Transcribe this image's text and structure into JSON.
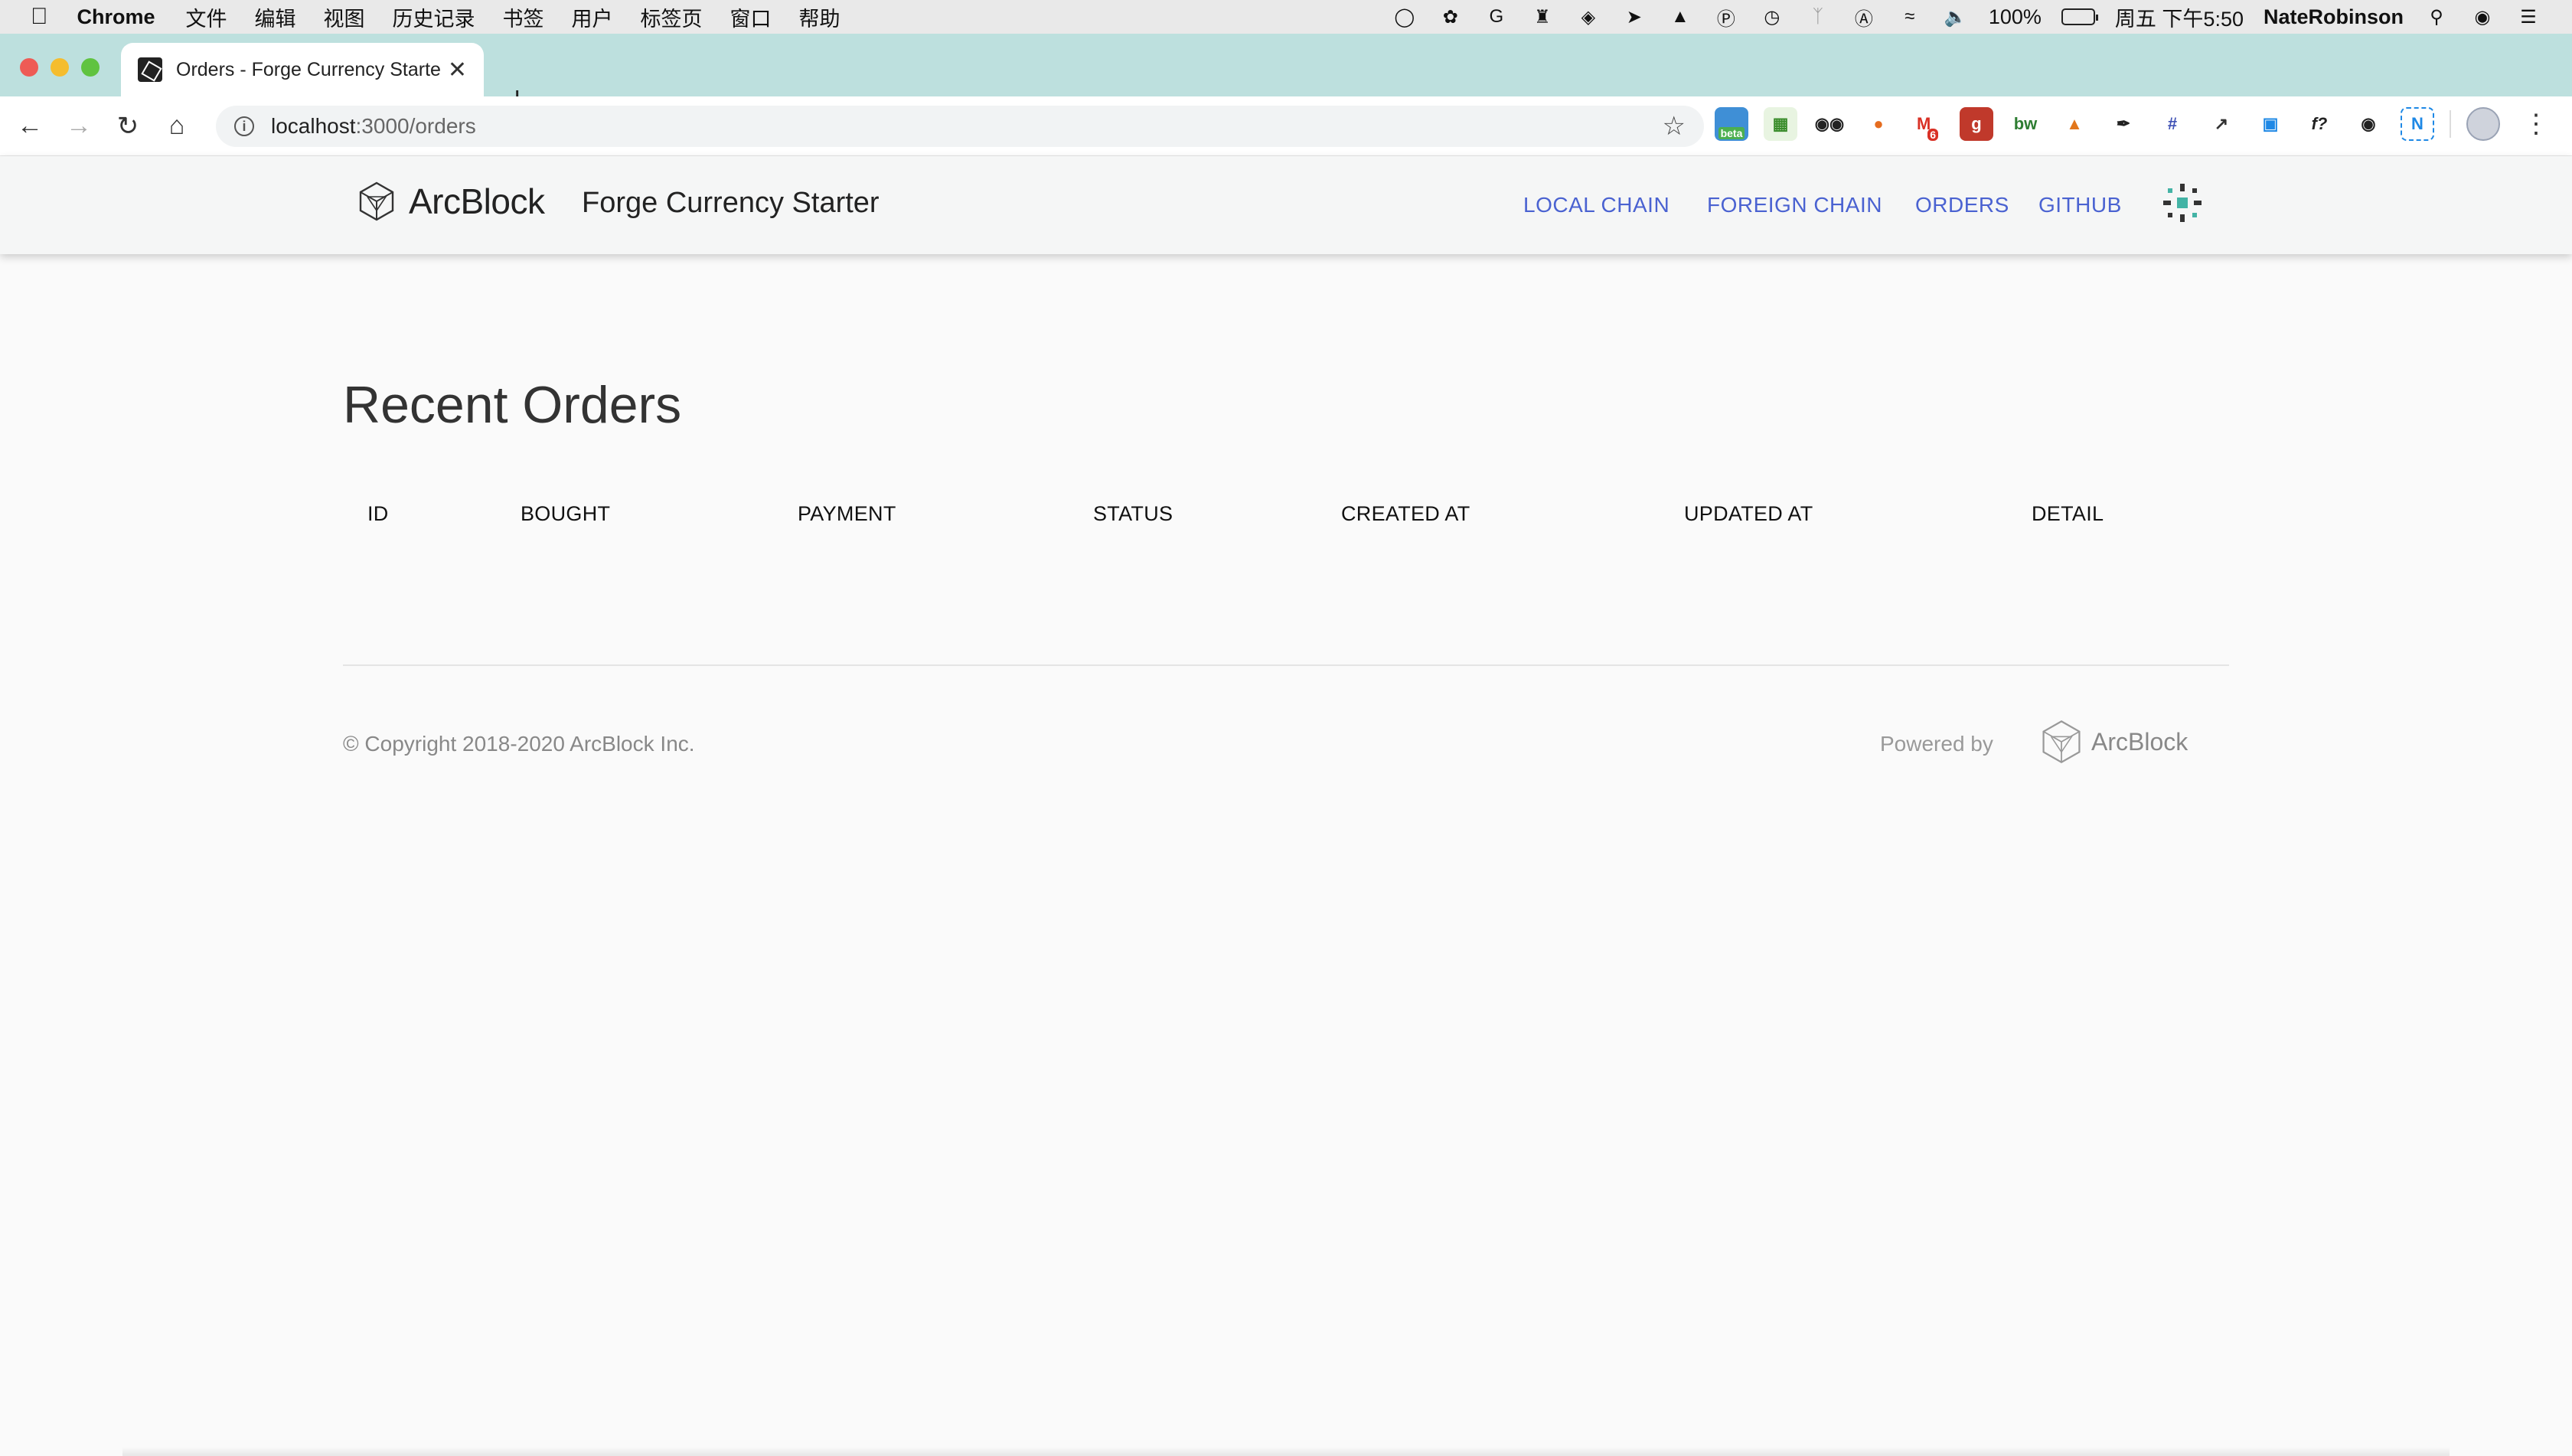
{
  "menubar": {
    "app_name": "Chrome",
    "menus": [
      "文件",
      "编辑",
      "视图",
      "历史记录",
      "书签",
      "用户",
      "标签页",
      "窗口",
      "帮助"
    ],
    "battery": "100%",
    "datetime": "周五 下午5:50",
    "user": "NateRobinson"
  },
  "browser": {
    "tab_title": "Orders - Forge Currency Starter",
    "url_host": "localhost",
    "url_path": ":3000/orders",
    "extension_badges": {
      "beta": "beta",
      "mail_count": "6"
    }
  },
  "header": {
    "brand": "ArcBlock",
    "title": "Forge Currency Starter",
    "nav": {
      "local_chain": "LOCAL CHAIN",
      "foreign_chain": "FOREIGN CHAIN",
      "orders": "ORDERS",
      "github": "GITHUB"
    }
  },
  "main": {
    "heading": "Recent Orders",
    "columns": [
      "ID",
      "BOUGHT",
      "PAYMENT",
      "STATUS",
      "CREATED AT",
      "UPDATED AT",
      "DETAIL"
    ]
  },
  "footer": {
    "copyright": "© Copyright 2018-2020  ArcBlock Inc.",
    "powered_by": "Powered by",
    "brand": "ArcBlock"
  },
  "colors": {
    "tabstrip": "#bde0de",
    "nav_link": "#4a62d1",
    "page_bg": "#fafafa"
  }
}
